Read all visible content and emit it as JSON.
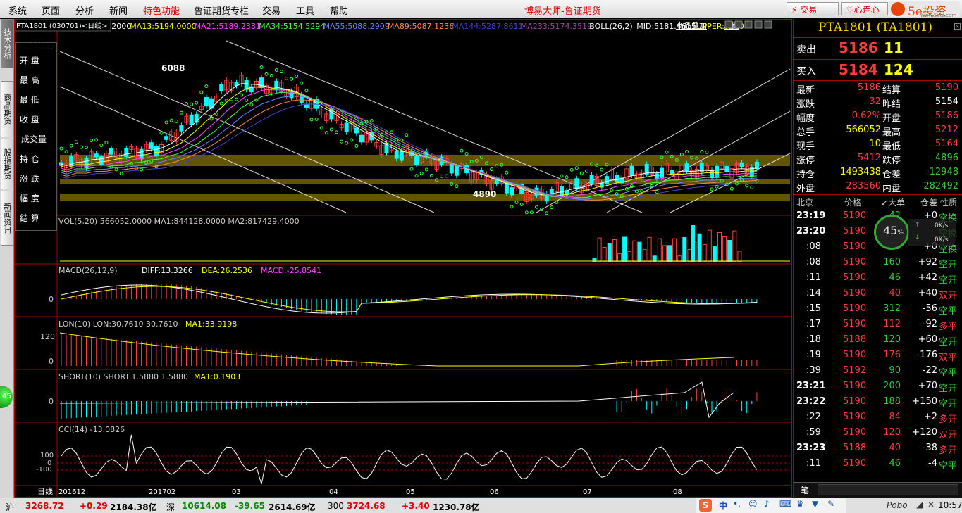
{
  "menu": [
    "系统",
    "页面",
    "分析",
    "新闻",
    "特色功能",
    "鲁证期货专栏",
    "交易",
    "工具",
    "帮助"
  ],
  "app_title": "博易大师-鲁证期货",
  "buttons": {
    "trade": "交易",
    "mood": "心连心"
  },
  "logo": {
    "brand": "5e投资",
    "url": "www.5etz.com"
  },
  "left_tabs": [
    "技术分析",
    "商品期货",
    "股指期货",
    "新闻资讯"
  ],
  "ohlc_labels": [
    "开 盘",
    "最 高",
    "最 低",
    "收 盘",
    "成交量",
    "持 仓",
    "涨 跌",
    "幅 度",
    "结 算"
  ],
  "chart": {
    "header_k": "K",
    "ma_items": [
      {
        "t": "MA5:5141.2000",
        "c": "#ffffff"
      },
      {
        "t": "MA13:5194.0000",
        "c": "#ffff00"
      },
      {
        "t": "MA21:5189.2381",
        "c": "#ff44ff"
      },
      {
        "t": "MA34:5154.5294",
        "c": "#44ff44"
      },
      {
        "t": "MA55:5088.2909",
        "c": "#6688ff"
      },
      {
        "t": "MA89:5087.1236",
        "c": "#ff8844"
      },
      {
        "t": "MA144:5287.8611",
        "c": "#4444cc"
      },
      {
        "t": "MA233:5174.3519",
        "c": "#aa44aa"
      },
      {
        "t": "BOLL(26,2)",
        "c": "#ffffff"
      },
      {
        "t": "MID:5181.4615",
        "c": "#ffffff"
      },
      {
        "t": "UPPER:5280",
        "c": "#ffff00"
      }
    ],
    "symbol": "PTA1801 (030701)<日线>",
    "overlay_label": "商品叠加",
    "period_label": "周期",
    "high_label": "6088",
    "low_label": "4890",
    "vol_label": "VOL(5,20) 566052.0000  MA1:844128.0000  MA2:817429.4000",
    "macd_label": "MACD(26,12,9)",
    "macd_diff": "DIFF:13.3266",
    "macd_dea": "DEA:26.2536",
    "macd_val": "MACD:-25.8541",
    "lon_label": "LON(10) LON:30.7610 30.7610",
    "lon_ma": "MA1:33.9198",
    "short_label": "SHORT(10) SHORT:1.5880 1.5880",
    "short_ma": "MA1:0.1903",
    "cci_label": "CCI(14) -13.0826",
    "axis": {
      "top_price": "6088",
      "macd0": "0",
      "lon120": "120",
      "lon0": "0",
      "short0": "0",
      "cci100": "100",
      "cci0": "0",
      "ccim100": "-100"
    },
    "period_name": "日线",
    "x_labels": [
      "201612",
      "201702",
      "03",
      "04",
      "05",
      "06",
      "07",
      "08"
    ]
  },
  "quote": {
    "title": "PTA1801 (TA1801)",
    "sell": {
      "label": "卖出",
      "price": "5186",
      "vol": "11"
    },
    "buy": {
      "label": "买入",
      "price": "5184",
      "vol": "124"
    },
    "rows": [
      [
        "最新",
        "5186",
        "结算",
        "5190"
      ],
      [
        "涨跌",
        "32",
        "昨结",
        "5154"
      ],
      [
        "幅度",
        "0.62%",
        "开盘",
        "5186"
      ],
      [
        "总手",
        "566052",
        "最高",
        "5212"
      ],
      [
        "现手",
        "10",
        "最低",
        "5164"
      ],
      [
        "涨停",
        "5412",
        "跌停",
        "4896"
      ],
      [
        "持仓",
        "1493438",
        "仓差",
        "-12948"
      ],
      [
        "外盘",
        "283560",
        "内盘",
        "282492"
      ]
    ],
    "tick_header": [
      "北京",
      "价格",
      "↙大单",
      "仓差",
      "性质"
    ],
    "ticks": [
      [
        "23:19",
        "5190",
        "42",
        "+0",
        "空换"
      ],
      [
        "23:20",
        "5190",
        "154",
        "",
        "空换"
      ],
      [
        ":08",
        "5190",
        "40",
        "+0",
        "空换"
      ],
      [
        ":08",
        "5190",
        "160",
        "+92",
        "空开"
      ],
      [
        ":11",
        "5190",
        "46",
        "+42",
        "空开"
      ],
      [
        ":14",
        "5190",
        "40",
        "+40",
        "双开"
      ],
      [
        ":15",
        "5190",
        "312",
        "-56",
        "空平"
      ],
      [
        ":17",
        "5190",
        "112",
        "-92",
        "多平"
      ],
      [
        ":18",
        "5188",
        "120",
        "+60",
        "空开"
      ],
      [
        ":19",
        "5190",
        "176",
        "-176",
        "双平"
      ],
      [
        ":39",
        "5192",
        "90",
        "-22",
        "空平"
      ],
      [
        "23:21",
        "5190",
        "200",
        "+70",
        "空开"
      ],
      [
        "23:22",
        "5190",
        "188",
        "+150",
        "空开"
      ],
      [
        ":22",
        "5190",
        "84",
        "+2",
        "多开"
      ],
      [
        ":59",
        "5190",
        "120",
        "+120",
        "双开"
      ],
      [
        "23:23",
        "5188",
        "40",
        "-38",
        "多开"
      ],
      [
        ":11",
        "5190",
        "46",
        "-4",
        "空平"
      ]
    ],
    "bottom_tab": "笔",
    "gauge": {
      "pct": "45",
      "unit": "%",
      "up": "0K/s",
      "down": "0K/s"
    }
  },
  "status": {
    "sh": {
      "label": "沪",
      "idx": "3268.72",
      "chg": "+0.29",
      "amt": "2184.38亿"
    },
    "sz": {
      "label": "深",
      "idx": "10614.08",
      "chg": "-39.65",
      "amt": "2614.69亿"
    },
    "c300": {
      "label": "300",
      "idx": "3724.68",
      "chg": "+3.40",
      "amt": "1230.78亿"
    },
    "ime": "中",
    "pobo": "Pobo",
    "time": "10:57"
  },
  "left_badge": "45"
}
